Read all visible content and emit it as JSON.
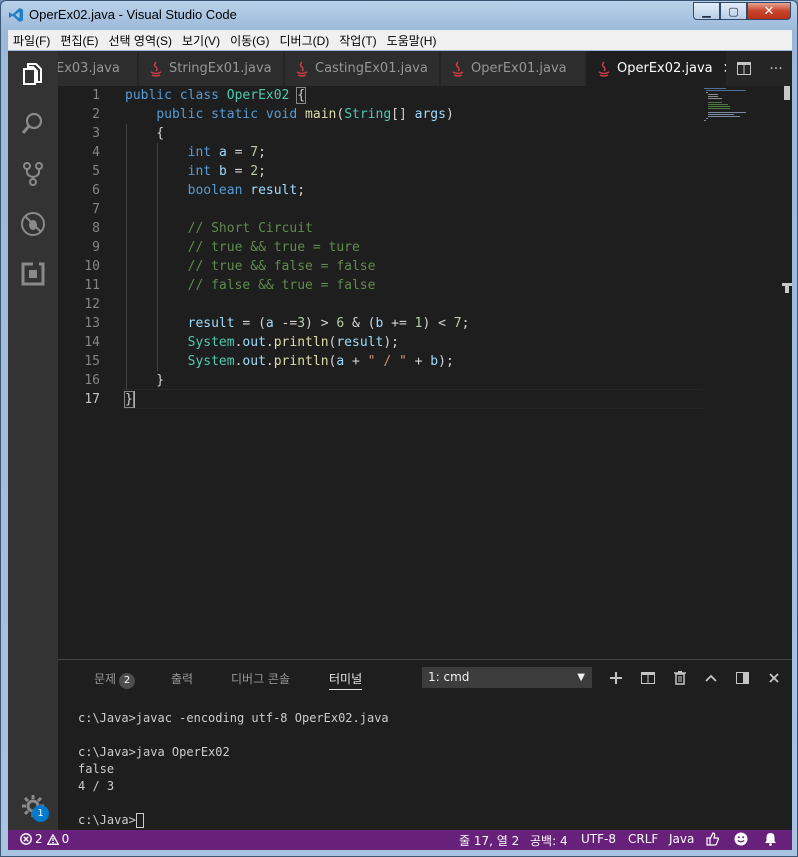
{
  "window": {
    "title": "OperEx02.java - Visual Studio Code"
  },
  "menu": [
    "파일(F)",
    "편집(E)",
    "선택 영역(S)",
    "보기(V)",
    "이동(G)",
    "디버그(D)",
    "작업(T)",
    "도움말(H)"
  ],
  "tabs": [
    {
      "label": "Ex03.java",
      "active": false
    },
    {
      "label": "StringEx01.java",
      "active": false
    },
    {
      "label": "CastingEx01.java",
      "active": false
    },
    {
      "label": "OperEx01.java",
      "active": false
    },
    {
      "label": "OperEx02.java",
      "active": true
    }
  ],
  "editor": {
    "line_numbers": [
      "1",
      "2",
      "3",
      "4",
      "5",
      "6",
      "7",
      "8",
      "9",
      "10",
      "11",
      "12",
      "13",
      "14",
      "15",
      "16",
      "17"
    ],
    "current_line": 17
  },
  "panel": {
    "tabs": [
      {
        "label": "문제",
        "badge": "2"
      },
      {
        "label": "출력"
      },
      {
        "label": "디버그 콘솔"
      },
      {
        "label": "터미널",
        "active": true
      }
    ],
    "terminal_select": "1: cmd",
    "terminal_lines": [
      "c:\\Java>javac -encoding utf-8 OperEx02.java",
      "",
      "c:\\Java>java OperEx02",
      "false",
      "4 / 3",
      "",
      "c:\\Java>"
    ]
  },
  "activity": {
    "settings_badge": "1"
  },
  "status": {
    "errors": "2",
    "warnings": "0",
    "position": "줄 17, 열 2",
    "indent": "공백: 4",
    "encoding": "UTF-8",
    "eol": "CRLF",
    "language": "Java"
  },
  "colors": {
    "statusbar": "#68217a",
    "activitybar": "#333333",
    "editor_bg": "#1e1e1e",
    "accent": "#007acc"
  }
}
